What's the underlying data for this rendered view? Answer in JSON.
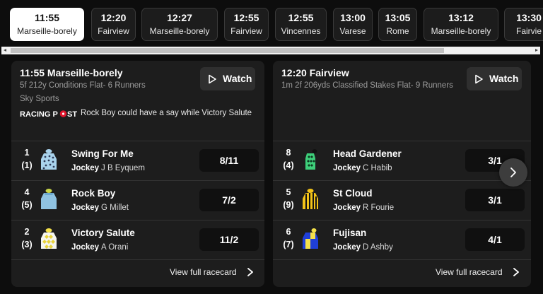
{
  "tabs": [
    {
      "time": "11:55",
      "venue": "Marseille-borely",
      "active": true
    },
    {
      "time": "12:20",
      "venue": "Fairview"
    },
    {
      "time": "12:27",
      "venue": "Marseille-borely"
    },
    {
      "time": "12:55",
      "venue": "Fairview"
    },
    {
      "time": "12:55",
      "venue": "Vincennes"
    },
    {
      "time": "13:00",
      "venue": "Varese"
    },
    {
      "time": "13:05",
      "venue": "Rome"
    },
    {
      "time": "13:12",
      "venue": "Marseille-borely"
    },
    {
      "time": "13:30",
      "venue": "Fairvie"
    }
  ],
  "colors": {
    "background": "#0d0d0d",
    "card": "#1d1d1d",
    "odds_button": "#101010",
    "watch_button": "#2f2f2f",
    "active_tab": "#ffffff",
    "racing_post_red": "#e2162d"
  },
  "watch_label": "Watch",
  "jockey_label": "Jockey",
  "view_racecard_label": "View full racecard",
  "racing_post_logo": {
    "text_left": "RACING P",
    "text_right": "ST"
  },
  "icons": [
    "play-icon",
    "racing-post-logo",
    "chevron-right-icon",
    "jockey-silk-icon"
  ],
  "cards": [
    {
      "title": "11:55 Marseille-borely",
      "subtitle": "5f 212y Conditions Flat- 6 Runners",
      "broadcaster": "Sky Sports",
      "racing_post_tip": "Rock Boy could have a say while Victory Salute",
      "runners": [
        {
          "number": "1",
          "draw": "(1)",
          "horse": "Swing For Me",
          "jockey": "J B Eyquem",
          "odds": "8/11",
          "silk": "light-blue-spots"
        },
        {
          "number": "4",
          "draw": "(5)",
          "horse": "Rock Boy",
          "jockey": "G Millet",
          "odds": "7/2",
          "silk": "light-blue-yellow-cap"
        },
        {
          "number": "2",
          "draw": "(3)",
          "horse": "Victory Salute",
          "jockey": "A Orani",
          "odds": "11/2",
          "silk": "white-yellow-diamonds"
        }
      ]
    },
    {
      "title": "12:20 Fairview",
      "subtitle": "1m 2f 206yds Classified Stakes Flat- 9 Runners",
      "runners": [
        {
          "number": "8",
          "draw": "(4)",
          "horse": "Head Gardener",
          "jockey": "C Habib",
          "odds": "3/1",
          "silk": "green-black-diamonds"
        },
        {
          "number": "5",
          "draw": "(9)",
          "horse": "St Cloud",
          "jockey": "R Fourie",
          "odds": "3/1",
          "silk": "yellow-black-stripes"
        },
        {
          "number": "6",
          "draw": "(7)",
          "horse": "Fujisan",
          "jockey": "D Ashby",
          "odds": "4/1",
          "silk": "blue-yellow-quartered"
        }
      ]
    }
  ]
}
